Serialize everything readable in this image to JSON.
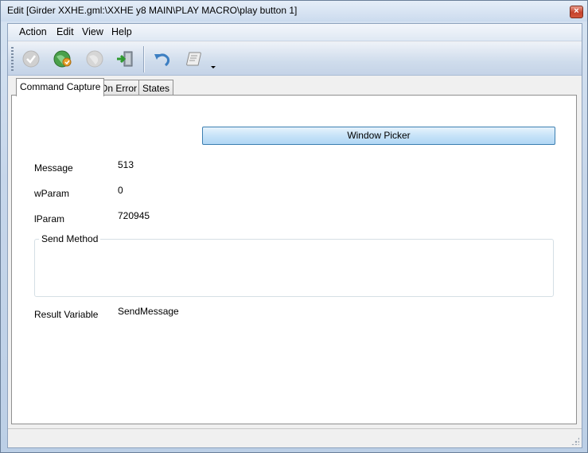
{
  "window": {
    "title": "Edit [Girder XXHE.gml:\\XXHE y8 MAIN\\PLAY MACRO\\play button 1]",
    "close_glyph": "×"
  },
  "menu": [
    "Action",
    "Edit",
    "View",
    "Help"
  ],
  "toolbar": {
    "buttons": [
      {
        "icon": "checkmark-icon",
        "enabled": false
      },
      {
        "icon": "globe-refresh-icon",
        "enabled": true
      },
      {
        "icon": "globe-icon",
        "enabled": false
      },
      {
        "icon": "exit-door-icon",
        "enabled": true
      },
      {
        "icon": "undo-icon",
        "enabled": true
      },
      {
        "icon": "scroll-icon",
        "enabled": true
      }
    ]
  },
  "tabs": [
    "Command Capture",
    "On Error",
    "States"
  ],
  "active_tab": "Command Capture",
  "form": {
    "window_picker_label": "Window Picker",
    "message_label": "Message",
    "message_value": "513",
    "wparam_label": "wParam",
    "wparam_value": "0",
    "lparam_label": "lParam",
    "lparam_value": "720945",
    "send_method_label": "Send Method",
    "result_variable_label": "Result Variable",
    "result_variable_value": "SendMessage"
  },
  "colors": {
    "accent_button": "#c7e3f8",
    "window_frame": "#c6d6ea"
  }
}
